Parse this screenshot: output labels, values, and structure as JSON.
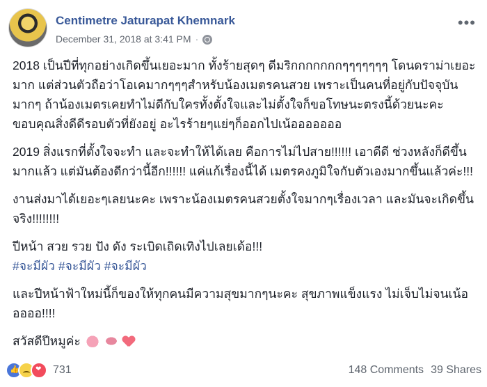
{
  "post": {
    "author": "Centimetre Jaturapat Khemnark",
    "timestamp": "December 31, 2018 at 3:41 PM",
    "separator": "·",
    "paragraphs": [
      "2018 เป็นปีที่ทุกอย่างเกิดขึ้นเยอะมาก ทั้งร้ายสุดๆ ดีมริกกกกกกกๆๆๆๆๆๆๆ โดนดราม่าเยอะมาก แต่ส่วนตัวถือว่าโอเคมากๆๆๆสำหรับน้องเมตรคนสวย เพราะเป็นคนที่อยู่กับปัจจุบันมากๆ ถ้าน้องเมตรเคยทำไม่ดีกับใครทั้งตั้งใจและไม่ตั้งใจก็ขอโทษนะตรงนี้ด้วยนะคะ ขอบคุณสิ่งดีดีรอบตัวที่ยังอยู่ อะไรร้ายๆแย่ๆก็ออกไปเน้อออออออ",
      "2019 สิ่งแรกที่ตั้งใจจะทำ และจะทำให้ได้เลย คือการไม่ไปสาย!!!!!! เอาดีดี ช่วงหลังก็ดีขึ้นมากแล้ว แต่มันต้องดีกว่านี้อีก!!!!!! แค่แก้เรื่องนี้ได้ เมตรคงภูมิใจกับตัวเองมากขึ้นแล้วค่ะ!!!",
      "งานส่งมาได้เยอะๆเลยนะคะ เพราะน้องเมตรคนสวยตั้งใจมากๆเรื่องเวลา และมันจะเกิดขึ้นจริง!!!!!!!!",
      "ปีหน้า สวย รวย ปัง ดัง ระเบิดเถิดเทิงไปเลยเด้อ!!!"
    ],
    "hashtags": [
      "#จะมีผัว",
      "#จะมีผัว",
      "#จะมีผัว"
    ],
    "paragraph_after_tags": "และปีหน้าฟ้าใหม่นี้ก็ของให้ทุกคนมีความสุขมากๆนะคะ สุขภาพแข็งแรง ไม่เจ็บไม่จนเน้อออออ!!!!",
    "closing": "สวัสดีปีหมูค่ะ",
    "reaction_count": "731",
    "comments": "148 Comments",
    "shares": "39 Shares"
  },
  "icons": {
    "avatar": "profile-photo",
    "privacy": "globe-icon",
    "more": "ellipsis-icon",
    "reactions": [
      "like-icon",
      "sad-icon",
      "heart-icon"
    ],
    "emojis": [
      "pig-face-emoji",
      "pig-nose-emoji",
      "heart-emoji"
    ]
  },
  "colors": {
    "link": "#385898",
    "text": "#1d2129",
    "muted": "#606770"
  }
}
